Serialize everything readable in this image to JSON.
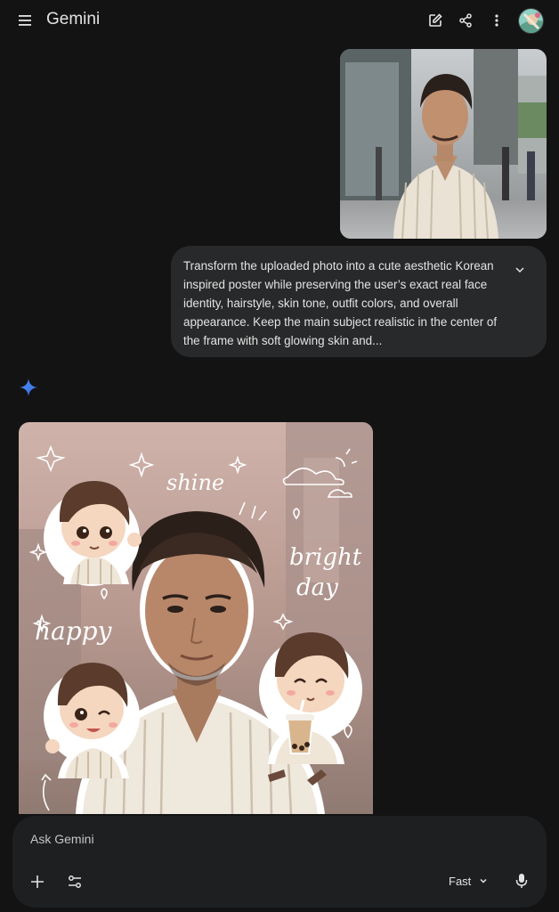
{
  "app": {
    "title": "Gemini"
  },
  "header": {
    "icons": [
      "menu-icon",
      "new-chat-icon",
      "share-icon",
      "more-vert-icon",
      "avatar"
    ]
  },
  "chat": {
    "user_message": "Transform the uploaded photo into a cute aesthetic Korean inspired poster while preserving the user’s exact real face identity, hairstyle, skin tone, outfit colors, and overall appearance. Keep the main subject realistic in the center of the frame with soft glowing skin and...",
    "poster_words": {
      "shine": "shine",
      "bright": "bright",
      "day": "day",
      "happy": "happy"
    }
  },
  "composer": {
    "placeholder": "Ask Gemini",
    "model_label": "Fast"
  },
  "colors": {
    "background": "#131314",
    "bubble": "#28292a",
    "composer": "#1e1f20",
    "text": "#e3e3e3",
    "accent": "#4285f4"
  }
}
